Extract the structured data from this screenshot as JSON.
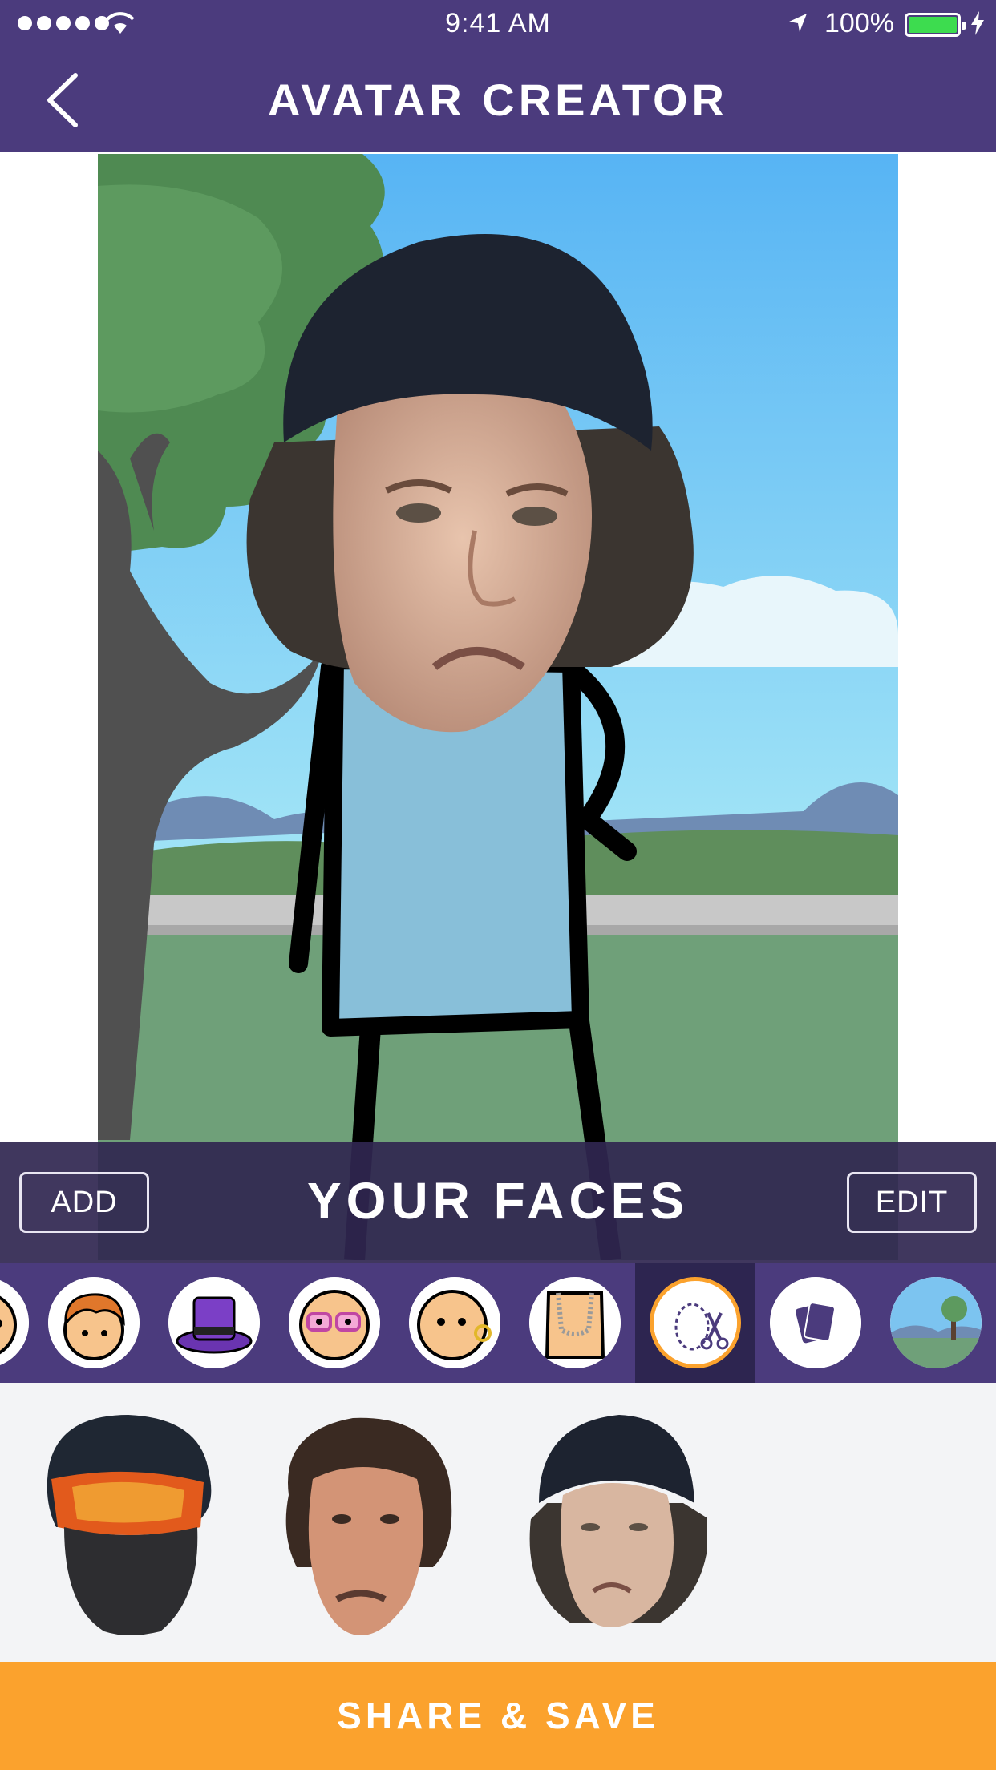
{
  "status_bar": {
    "time": "9:41 AM",
    "battery_text": "100%",
    "battery_color": "#3ddc4f"
  },
  "header": {
    "title": "AVATAR CREATOR",
    "back_icon": "chevron-left-icon",
    "background": "#4b3b7d"
  },
  "faces_bar": {
    "title": "YOUR FACES",
    "add_label": "ADD",
    "edit_label": "EDIT"
  },
  "categories": [
    {
      "name": "face-partial",
      "icon": "face-icon"
    },
    {
      "name": "hair",
      "icon": "hair-icon"
    },
    {
      "name": "hat",
      "icon": "top-hat-icon"
    },
    {
      "name": "glasses",
      "icon": "glasses-icon"
    },
    {
      "name": "ears",
      "icon": "earring-icon"
    },
    {
      "name": "necklace",
      "icon": "necklace-icon"
    },
    {
      "name": "cut-face",
      "icon": "scissors-icon",
      "selected": true
    },
    {
      "name": "cards",
      "icon": "cards-icon"
    },
    {
      "name": "background",
      "icon": "landscape-icon"
    }
  ],
  "faces": [
    {
      "name": "face-helmet"
    },
    {
      "name": "face-curly-hair"
    },
    {
      "name": "face-beanie"
    }
  ],
  "share_label": "SHARE & SAVE",
  "accent": "#fba22d"
}
